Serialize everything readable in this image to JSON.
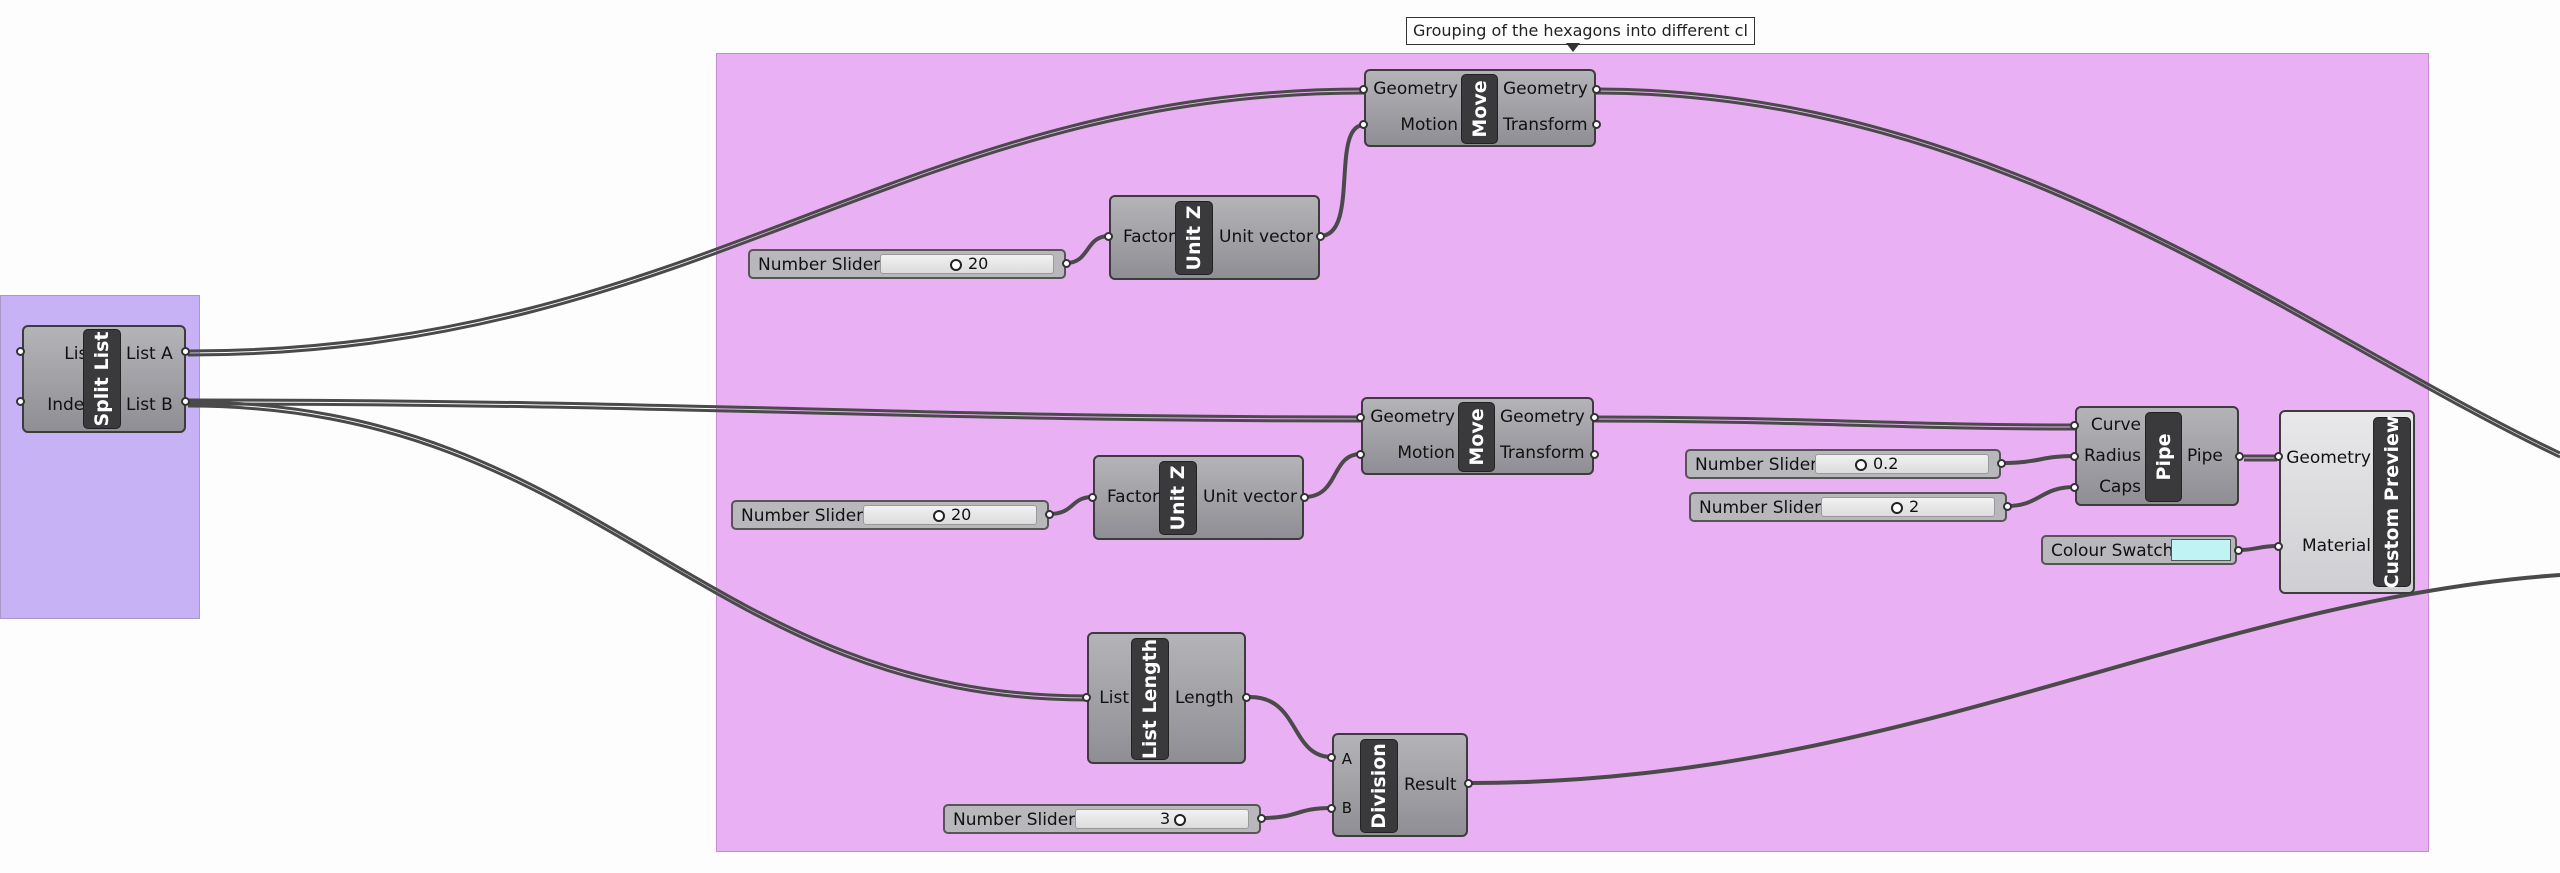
{
  "tooltip": "Grouping of the hexagons into different cl",
  "split_list": {
    "title": "Split List",
    "inputs": [
      "List",
      "Index"
    ],
    "outputs": [
      "List A",
      "List B"
    ]
  },
  "move1": {
    "title": "Move",
    "inputs": [
      "Geometry",
      "Motion"
    ],
    "outputs": [
      "Geometry",
      "Transform"
    ]
  },
  "move2": {
    "title": "Move",
    "inputs": [
      "Geometry",
      "Motion"
    ],
    "outputs": [
      "Geometry",
      "Transform"
    ]
  },
  "unitz1": {
    "title": "Unit Z",
    "input": "Factor",
    "output": "Unit vector"
  },
  "unitz2": {
    "title": "Unit Z",
    "input": "Factor",
    "output": "Unit vector"
  },
  "slider1": {
    "name": "Number Slider",
    "value": "20"
  },
  "slider2": {
    "name": "Number Slider",
    "value": "20"
  },
  "slider3": {
    "name": "Number Slider",
    "value": "0.2"
  },
  "slider4": {
    "name": "Number Slider",
    "value": "2"
  },
  "slider5": {
    "name": "Number Slider",
    "value": "3"
  },
  "pipe": {
    "title": "Pipe",
    "inputs": [
      "Curve",
      "Radius",
      "Caps"
    ],
    "output": "Pipe"
  },
  "custom_preview": {
    "title": "Custom Preview",
    "inputs": [
      "Geometry",
      "Material"
    ]
  },
  "colour_swatch": {
    "name": "Colour Swatch",
    "color": "#bff3f4"
  },
  "list_length": {
    "title": "List Length",
    "input": "List",
    "output": "Length"
  },
  "division": {
    "title": "Division",
    "inputs": [
      "A",
      "B"
    ],
    "output": "Result"
  },
  "colors": {
    "group_blue": "#c7b2f6",
    "group_pink": "#eab0f4",
    "wire": "#4a4a4a"
  }
}
